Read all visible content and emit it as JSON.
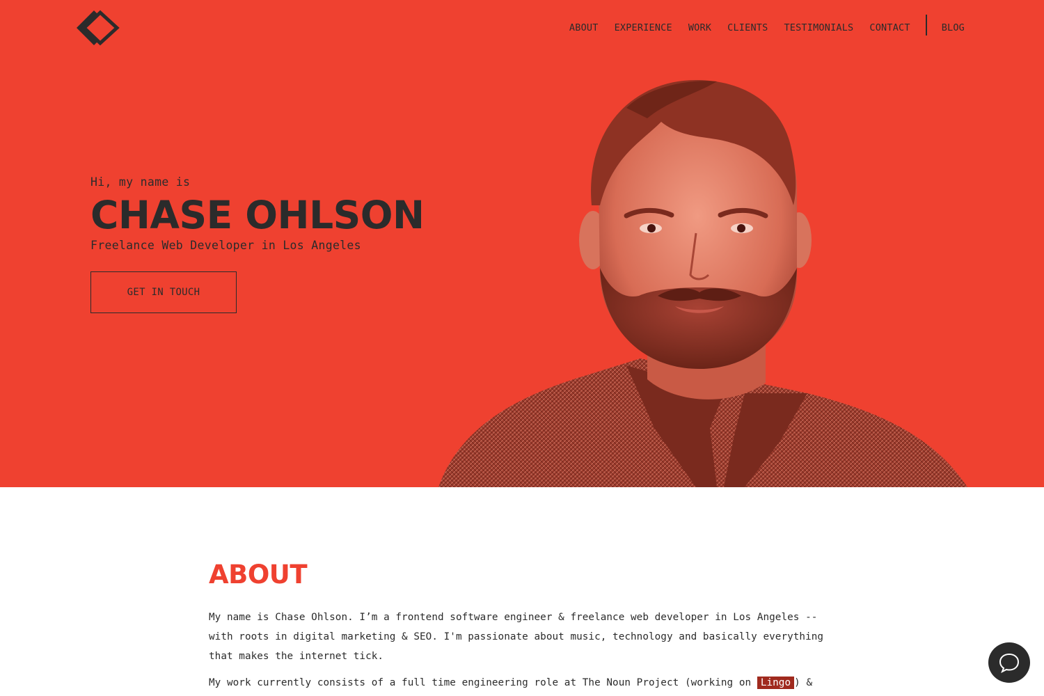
{
  "nav": {
    "items": [
      "ABOUT",
      "EXPERIENCE",
      "WORK",
      "CLIENTS",
      "TESTIMONIALS",
      "CONTACT"
    ],
    "blog": "BLOG"
  },
  "hero": {
    "greeting": "Hi, my name is",
    "name": "CHASE OHLSON",
    "subtitle": "Freelance Web Developer in Los Angeles",
    "cta": "GET IN TOUCH"
  },
  "about": {
    "heading": "ABOUT",
    "paragraph1": "My name is Chase Ohlson. I’m a frontend software engineer & freelance web developer in Los Angeles -- with roots in digital marketing & SEO. I'm passionate about music, technology and basically everything that makes the internet tick.",
    "paragraph2_before": "My work currently consists of a full time engineering role at The Noun Project (working on ",
    "paragraph2_link": "Lingo",
    "paragraph2_after": ") &"
  },
  "colors": {
    "brand": "#ef4130",
    "text": "#2b2b2b",
    "highlight": "#a02a1e"
  },
  "icons": {
    "logo": "diamond-logo-icon",
    "chat": "chat-bubble-icon"
  }
}
